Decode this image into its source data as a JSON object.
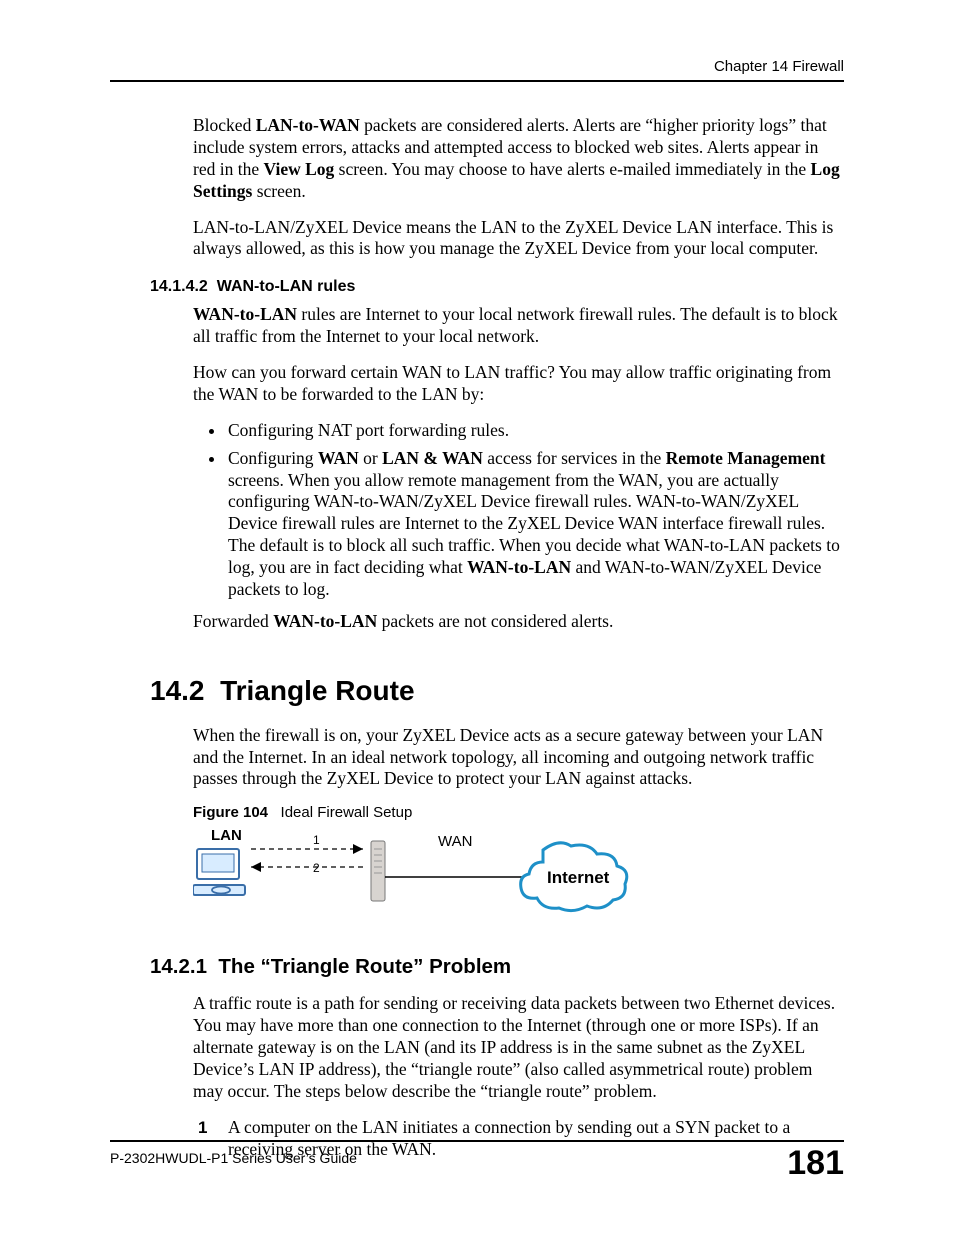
{
  "header": {
    "chapter": "Chapter 14 Firewall"
  },
  "para1": {
    "t1": "Blocked ",
    "b1": "LAN-to-WAN",
    "t2": " packets are considered alerts. Alerts are “higher priority logs” that include system errors, attacks and attempted access to blocked web sites. Alerts appear in red in the ",
    "b2": "View Log",
    "t3": " screen. You may choose to have alerts e-mailed immediately in the ",
    "b3": "Log Settings",
    "t4": " screen."
  },
  "para2": "LAN-to-LAN/ZyXEL Device means the LAN to the ZyXEL Device LAN interface. This is always allowed, as this is how you manage the ZyXEL Device from your local computer.",
  "sec14142": {
    "num": "14.1.4.2",
    "title": "WAN-to-LAN rules"
  },
  "para3": {
    "b1": "WAN-to-LAN",
    "t2": " rules are Internet to your local network firewall rules. The default is to block all traffic from the Internet to your local network."
  },
  "para4": "How can you forward certain WAN to LAN traffic? You may allow traffic originating from the WAN to be forwarded to the LAN by:",
  "bullet1": "Configuring NAT port forwarding rules.",
  "bullet2": {
    "t1": "Configuring ",
    "b1": "WAN",
    "t2": " or ",
    "b2": "LAN & WAN",
    "t3": " access for services in the ",
    "b3": "Remote Management",
    "t4": " screens. When you allow remote management from the WAN, you are actually configuring WAN-to-WAN/ZyXEL Device firewall rules. WAN-to-WAN/ZyXEL Device firewall rules are Internet to the ZyXEL Device WAN interface firewall rules. The default is to block all such traffic. When you decide what WAN-to-LAN packets to log, you are in fact deciding what ",
    "b4": "WAN-to-LAN",
    "t5": " and WAN-to-WAN/ZyXEL Device packets to log."
  },
  "para5": {
    "t1": "Forwarded ",
    "b1": "WAN-to-LAN",
    "t2": " packets are not considered alerts."
  },
  "sec142": {
    "num": "14.2",
    "title": "Triangle Route"
  },
  "para6": "When the firewall is on, your ZyXEL Device acts as a secure gateway between your LAN and the Internet. In an ideal network topology, all incoming and outgoing network traffic passes through the ZyXEL Device to protect your LAN against attacks.",
  "fig": {
    "label": "Figure 104",
    "caption": "Ideal Firewall Setup",
    "lan": "LAN",
    "wan": "WAN",
    "n1": "1",
    "n2": "2",
    "internet": "Internet"
  },
  "sec1421": {
    "num": "14.2.1",
    "title": "The “Triangle Route” Problem"
  },
  "para7": "A traffic route is a path for sending or receiving data packets between two Ethernet devices. You may have more than one connection to the Internet (through one or more ISPs). If an alternate gateway is on the LAN (and its IP address is in the same subnet as the ZyXEL Device’s LAN IP address), the “triangle route” (also called asymmetrical route) problem may occur. The steps below describe the “triangle route” problem.",
  "step1": {
    "marker": "1",
    "text": "A computer on the LAN initiates a connection by sending out a SYN packet to a receiving server on the WAN."
  },
  "footer": {
    "guide": "P-2302HWUDL-P1 Series User’s Guide",
    "page": "181"
  }
}
